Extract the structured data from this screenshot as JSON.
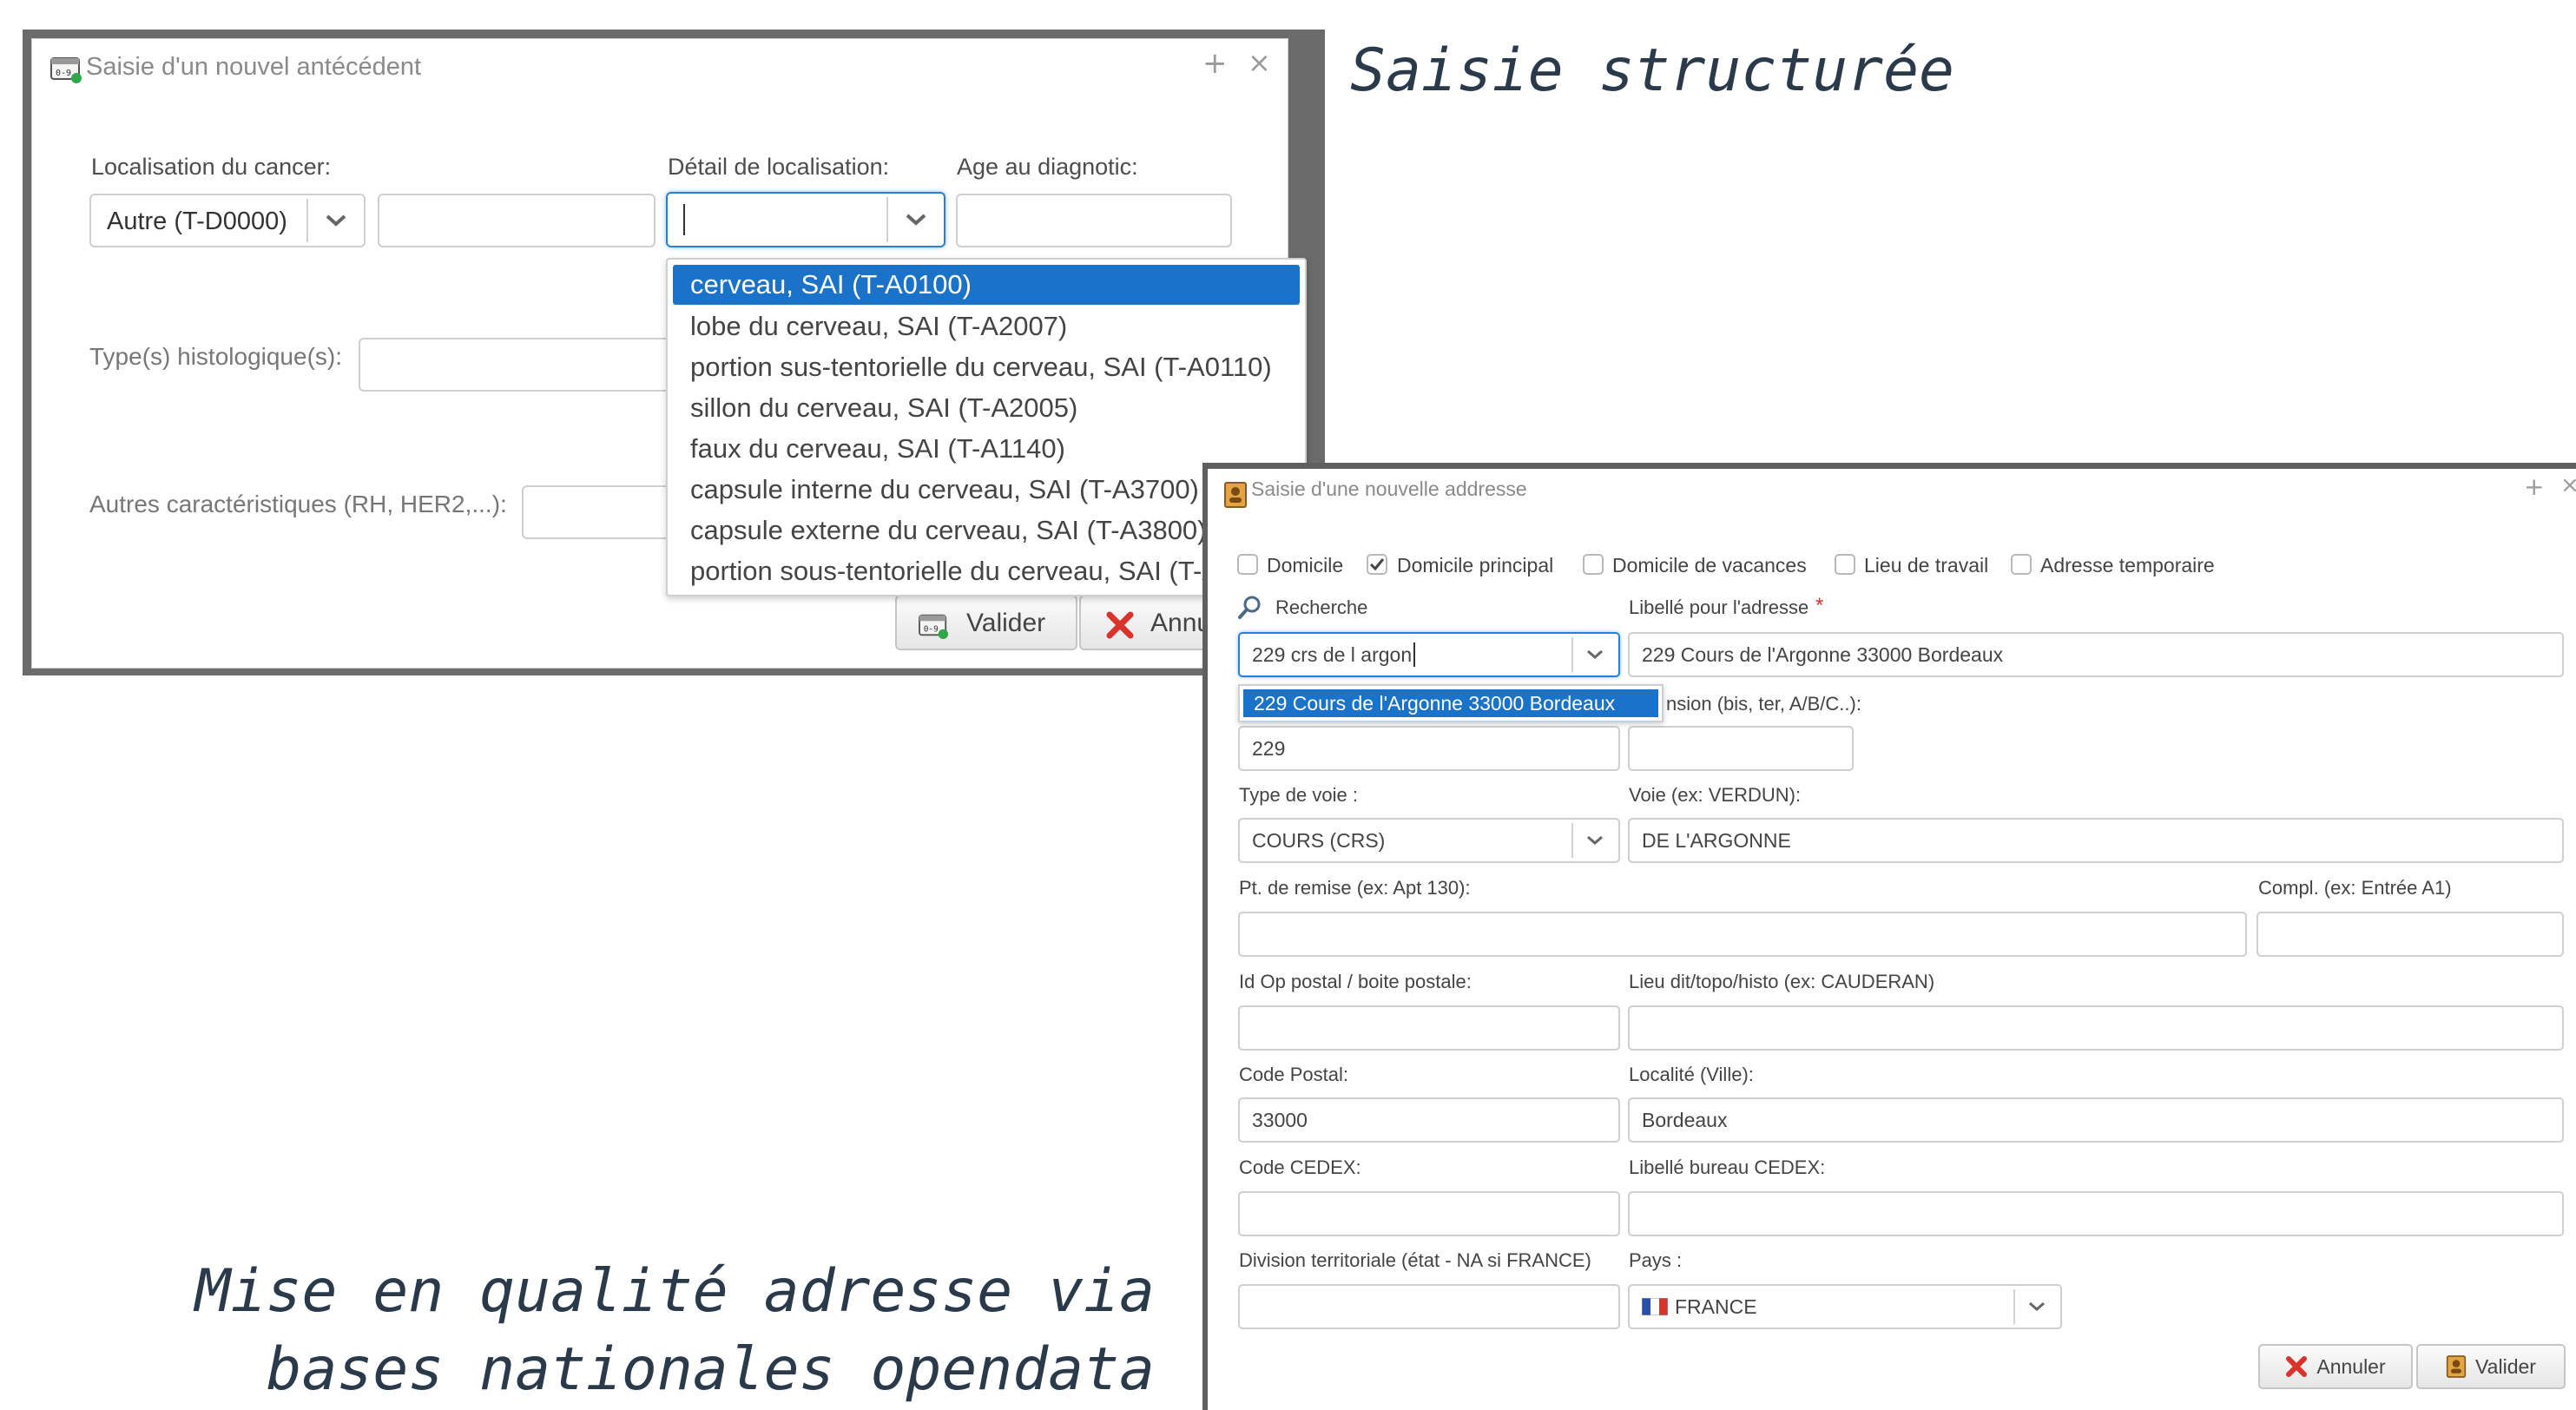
{
  "captions": {
    "top_right": "Saisie structurée",
    "bottom_left_line1": "Mise en qualité adresse via",
    "bottom_left_line2": "bases nationales opendata"
  },
  "dialog1": {
    "title": "Saisie d'un nouvel antécédent",
    "labels": {
      "localisation": "Localisation du cancer:",
      "detail": "Détail de localisation:",
      "age": "Age au diagnotic:",
      "histo": "Type(s) histologique(s):",
      "autres": "Autres caractéristiques (RH, HER2,...):"
    },
    "localisation_value": "Autre (T-D0000)",
    "dropdown_options": [
      "cerveau, SAI (T-A0100)",
      "lobe du cerveau, SAI (T-A2007)",
      "portion sus-tentorielle du cerveau, SAI (T-A0110)",
      "sillon du cerveau, SAI (T-A2005)",
      "faux du cerveau, SAI (T-A1140)",
      "capsule interne du cerveau, SAI (T-A3700)",
      "capsule externe du cerveau, SAI (T-A3800)",
      "portion sous-tentorielle du cerveau, SAI (T-A"
    ],
    "buttons": {
      "valider": "Valider",
      "annuler": "Annu"
    }
  },
  "dialog2": {
    "title": "Saisie d'une nouvelle addresse",
    "checkboxes": [
      {
        "label": "Domicile",
        "checked": false
      },
      {
        "label": "Domicile principal",
        "checked": true
      },
      {
        "label": "Domicile de vacances",
        "checked": false
      },
      {
        "label": "Lieu de travail",
        "checked": false
      },
      {
        "label": "Adresse temporaire",
        "checked": false
      }
    ],
    "labels": {
      "recherche": "Recherche",
      "libelle": "Libellé pour l'adresse",
      "extension": "nsion (bis, ter, A/B/C..):",
      "type_voie": "Type de voie :",
      "voie": "Voie (ex: VERDUN):",
      "pt_remise": "Pt. de remise (ex: Apt 130):",
      "compl": "Compl. (ex: Entrée A1)",
      "id_op": "Id Op postal / boite postale:",
      "lieu_dit": "Lieu dit/topo/histo (ex: CAUDERAN)",
      "code_postal": "Code Postal:",
      "localite": "Localité (Ville):",
      "code_cedex": "Code CEDEX:",
      "libelle_cedex": "Libellé bureau CEDEX:",
      "division": "Division territoriale (état - NA si FRANCE)",
      "pays": "Pays :"
    },
    "values": {
      "recherche": "229 crs de l argon",
      "suggestion": "229 Cours de l'Argonne 33000 Bordeaux",
      "libelle": "229 Cours de l'Argonne 33000 Bordeaux",
      "numero": "229",
      "extension": "",
      "type_voie": "COURS (CRS)",
      "voie": "DE L'ARGONNE",
      "pt_remise": "",
      "compl": "",
      "id_op": "",
      "lieu_dit": "",
      "code_postal": "33000",
      "localite": "Bordeaux",
      "code_cedex": "",
      "libelle_cedex": "",
      "division": "",
      "pays": "FRANCE"
    },
    "required_mark": "*",
    "buttons": {
      "annuler": "Annuler",
      "valider": "Valider"
    }
  },
  "colors": {
    "selection": "#1a73c9",
    "cancel_red": "#d9342b",
    "required_red": "#d9342b",
    "caption": "#2b3a4a"
  }
}
